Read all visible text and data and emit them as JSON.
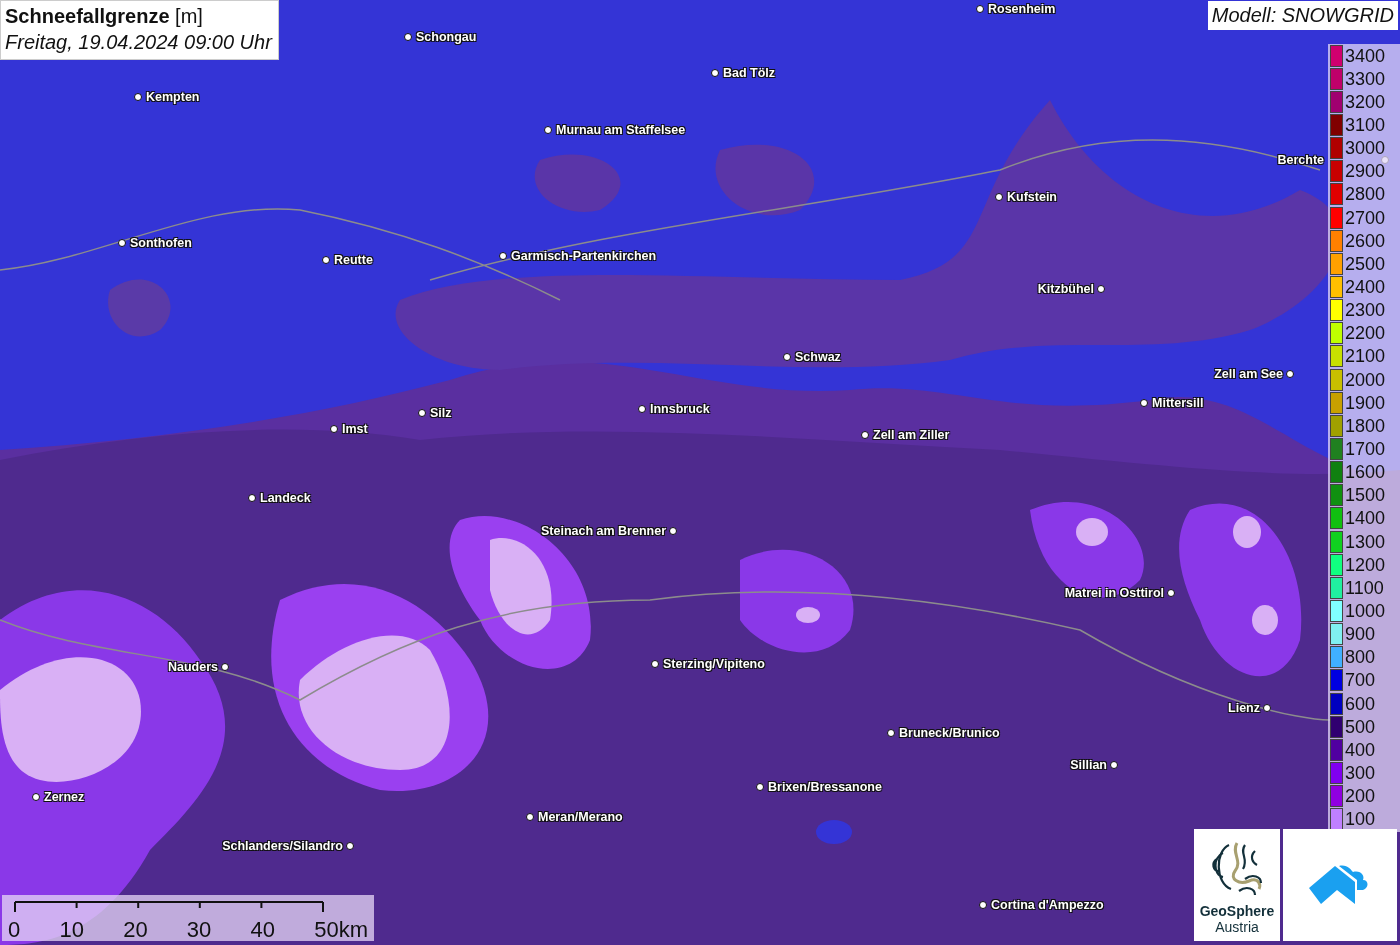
{
  "title": {
    "heading": "**Schneefallgrenze** [m]",
    "subtitle": "Freitag, 19.04.2024 09:00 Uhr"
  },
  "model": "Modell: SNOWGRID",
  "cities": [
    {
      "name": "Schongau"
    },
    {
      "name": "Rosenheim"
    },
    {
      "name": "Bad Tölz"
    },
    {
      "name": "Kempten"
    },
    {
      "name": "Murnau am Staffelsee"
    },
    {
      "name": "Berchte"
    },
    {
      "name": "Kufstein"
    },
    {
      "name": "Sonthofen"
    },
    {
      "name": "Reutte"
    },
    {
      "name": "Garmisch-Partenkirchen"
    },
    {
      "name": "Kitzbühel"
    },
    {
      "name": "Schwaz"
    },
    {
      "name": "Zell am See"
    },
    {
      "name": "Mittersill"
    },
    {
      "name": "Silz"
    },
    {
      "name": "Innsbruck"
    },
    {
      "name": "Imst"
    },
    {
      "name": "Zell am Ziller"
    },
    {
      "name": "Landeck"
    },
    {
      "name": "Steinach am Brenner"
    },
    {
      "name": "Matrei in Osttirol"
    },
    {
      "name": "Nauders"
    },
    {
      "name": "Sterzing/Vipiteno"
    },
    {
      "name": "Lienz"
    },
    {
      "name": "Bruneck/Brunico"
    },
    {
      "name": "Sillian"
    },
    {
      "name": "Brixen/Bressanone"
    },
    {
      "name": "Zernez"
    },
    {
      "name": "Meran/Merano"
    },
    {
      "name": "Schlanders/Silandro"
    },
    {
      "name": "Cortina d'Ampezzo"
    }
  ],
  "legend": [
    {
      "label": "3400",
      "color": "#d0006f"
    },
    {
      "label": "3300",
      "color": "#c0006a"
    },
    {
      "label": "3200",
      "color": "#a00070"
    },
    {
      "label": "3100",
      "color": "#800000"
    },
    {
      "label": "3000",
      "color": "#b00000"
    },
    {
      "label": "2900",
      "color": "#c80000"
    },
    {
      "label": "2800",
      "color": "#e00000"
    },
    {
      "label": "2700",
      "color": "#ff0000"
    },
    {
      "label": "2600",
      "color": "#ff8000"
    },
    {
      "label": "2500",
      "color": "#ffa000"
    },
    {
      "label": "2400",
      "color": "#ffc000"
    },
    {
      "label": "2300",
      "color": "#ffff00"
    },
    {
      "label": "2200",
      "color": "#c0ff00"
    },
    {
      "label": "2100",
      "color": "#c8e000"
    },
    {
      "label": "2000",
      "color": "#c8c000"
    },
    {
      "label": "1900",
      "color": "#c8a000"
    },
    {
      "label": "1800",
      "color": "#a0a000"
    },
    {
      "label": "1700",
      "color": "#208020"
    },
    {
      "label": "1600",
      "color": "#108010"
    },
    {
      "label": "1500",
      "color": "#109010"
    },
    {
      "label": "1400",
      "color": "#10c010"
    },
    {
      "label": "1300",
      "color": "#10d020"
    },
    {
      "label": "1200",
      "color": "#10ff80"
    },
    {
      "label": "1100",
      "color": "#20f0a0"
    },
    {
      "label": "1000",
      "color": "#80ffff"
    },
    {
      "label": "900",
      "color": "#80f0f0"
    },
    {
      "label": "800",
      "color": "#40b0ff"
    },
    {
      "label": "700",
      "color": "#0000e0"
    },
    {
      "label": "600",
      "color": "#0000c0"
    },
    {
      "label": "500",
      "color": "#300070"
    },
    {
      "label": "400",
      "color": "#5000a0"
    },
    {
      "label": "300",
      "color": "#8000f0"
    },
    {
      "label": "200",
      "color": "#9000e0"
    },
    {
      "label": "100",
      "color": "#c080ff"
    }
  ],
  "scale_bar": [
    "0",
    "10",
    "20",
    "30",
    "40",
    "50km"
  ],
  "logos": {
    "name": "GeoSphere",
    "sub": "Austria"
  }
}
